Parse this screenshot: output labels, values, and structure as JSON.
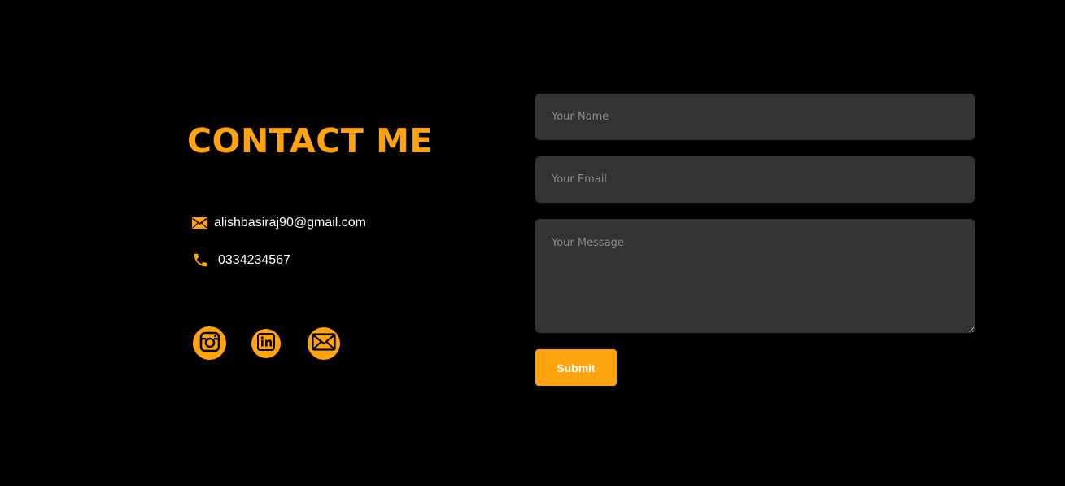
{
  "contact": {
    "title": "CONTACT ME",
    "email": "alishbasiraj90@gmail.com",
    "email_icon": "mail-icon",
    "phone": "0334234567",
    "phone_icon": "phone-icon"
  },
  "socials": [
    {
      "name": "instagram",
      "icon": "instagram-icon"
    },
    {
      "name": "linkedin",
      "icon": "linkedin-icon"
    },
    {
      "name": "email",
      "icon": "envelope-icon"
    }
  ],
  "form": {
    "name_placeholder": "Your Name",
    "email_placeholder": "Your Email",
    "message_placeholder": "Your Message",
    "name_value": "",
    "email_value": "",
    "message_value": "",
    "submit_label": "Submit"
  },
  "colors": {
    "background": "#000000",
    "accent": "#ffa30f",
    "field_background": "#333333",
    "text": "#ffffff"
  }
}
